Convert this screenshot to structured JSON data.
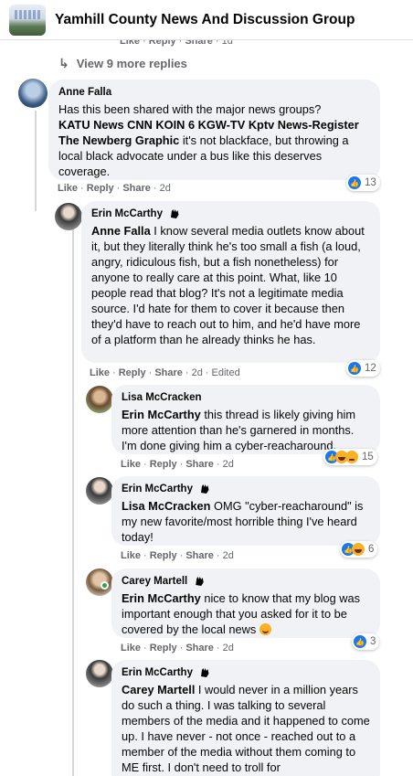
{
  "header": {
    "group_title": "Yamhill County News And Discussion Group"
  },
  "fragment": {
    "like": "Like",
    "reply": "Reply",
    "share": "Share",
    "time": "1d"
  },
  "view_more": {
    "label": "View 9 more replies"
  },
  "comments": [
    {
      "author": "Anne Falla",
      "mention": "",
      "pre_bold": "Has this been shared with the major news groups?",
      "bold_text": "KATU News CNN KOIN 6 KGW-TV Kptv News-Register The Newberg Graphic",
      "text": " it's not blackface, but throwing a local black advocate under a bus like this deserves coverage.",
      "like": "Like",
      "reply": "Reply",
      "share": "Share",
      "time": "2d",
      "reaction_count": "13"
    },
    {
      "author": "Erin McCarthy",
      "mention": "Anne Falla",
      "text": " I know several media outlets know about it, but they literally think he's too small a fish (a loud, angry, ridiculous fish, but a fish nonetheless) for anyone to really care at this point. What, like 10 people read that blog? It's not a legitimate media source. I'd hate for them to cover it because then they'd have to reach out to him, and he'd have more of a platform than he already thinks he has.",
      "like": "Like",
      "reply": "Reply",
      "share": "Share",
      "time": "2d",
      "edited": "Edited",
      "reaction_count": "12"
    },
    {
      "author": "Lisa McCracken",
      "mention": "Erin McCarthy",
      "text": " this thread is likely giving him more attention than he's garnered in months. I'm done giving him a cyber-reacharound.",
      "like": "Like",
      "reply": "Reply",
      "share": "Share",
      "time": "2d",
      "reaction_count": "15"
    },
    {
      "author": "Erin McCarthy",
      "mention": "Lisa McCracken",
      "text": " OMG \"cyber-reacharound\" is my new favorite/most horrible thing I've heard today!",
      "like": "Like",
      "reply": "Reply",
      "share": "Share",
      "time": "2d",
      "reaction_count": "6"
    },
    {
      "author": "Carey Martell",
      "mention": "Erin McCarthy",
      "text": " nice to know that my blog was important enough that you asked for it to be covered by the local news ",
      "like": "Like",
      "reply": "Reply",
      "share": "Share",
      "time": "2d",
      "reaction_count": "3"
    },
    {
      "author": "Erin McCarthy",
      "mention": "Carey Martell",
      "text": " I would never in a million years do such a thing. I was talking to several members of the media and it happened to come up. I have never - not once - reached out to a member of the media without them coming to ME first. I don't need to troll for"
    }
  ],
  "colors": {
    "link": "#050505",
    "meta": "#65676b",
    "bubble": "#f0f2f5",
    "like_blue": "#1877f2"
  },
  "icons": [
    "group-thumbnail",
    "reply-arrow-icon",
    "top-fan-badge-icon",
    "like-reaction-icon",
    "haha-reaction-icon",
    "sad-reaction-icon",
    "smile-emoji-icon"
  ]
}
